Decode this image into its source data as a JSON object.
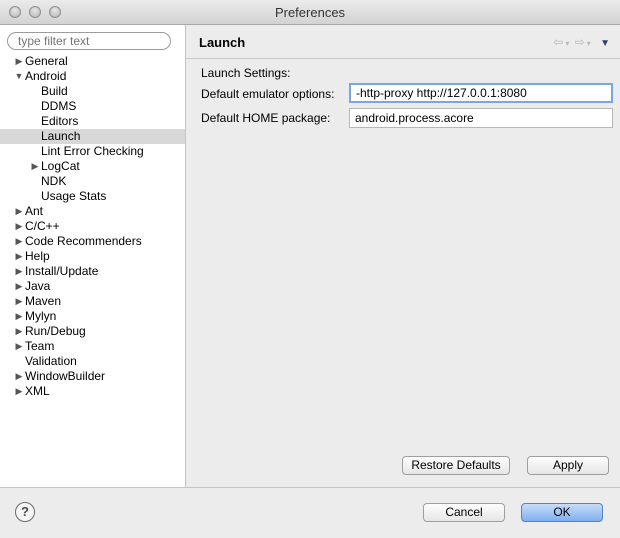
{
  "window": {
    "title": "Preferences"
  },
  "filter": {
    "placeholder": "type filter text"
  },
  "tree": [
    {
      "label": "General",
      "level": 0,
      "arrow": "right"
    },
    {
      "label": "Android",
      "level": 0,
      "arrow": "down"
    },
    {
      "label": "Build",
      "level": 1,
      "arrow": ""
    },
    {
      "label": "DDMS",
      "level": 1,
      "arrow": ""
    },
    {
      "label": "Editors",
      "level": 1,
      "arrow": ""
    },
    {
      "label": "Launch",
      "level": 1,
      "arrow": "",
      "selected": true
    },
    {
      "label": "Lint Error Checking",
      "level": 1,
      "arrow": ""
    },
    {
      "label": "LogCat",
      "level": 1,
      "arrow": "right"
    },
    {
      "label": "NDK",
      "level": 1,
      "arrow": ""
    },
    {
      "label": "Usage Stats",
      "level": 1,
      "arrow": ""
    },
    {
      "label": "Ant",
      "level": 0,
      "arrow": "right"
    },
    {
      "label": "C/C++",
      "level": 0,
      "arrow": "right"
    },
    {
      "label": "Code Recommenders",
      "level": 0,
      "arrow": "right"
    },
    {
      "label": "Help",
      "level": 0,
      "arrow": "right"
    },
    {
      "label": "Install/Update",
      "level": 0,
      "arrow": "right"
    },
    {
      "label": "Java",
      "level": 0,
      "arrow": "right"
    },
    {
      "label": "Maven",
      "level": 0,
      "arrow": "right"
    },
    {
      "label": "Mylyn",
      "level": 0,
      "arrow": "right"
    },
    {
      "label": "Run/Debug",
      "level": 0,
      "arrow": "right"
    },
    {
      "label": "Team",
      "level": 0,
      "arrow": "right"
    },
    {
      "label": "Validation",
      "level": 0,
      "arrow": ""
    },
    {
      "label": "WindowBuilder",
      "level": 0,
      "arrow": "right"
    },
    {
      "label": "XML",
      "level": 0,
      "arrow": "right"
    }
  ],
  "page": {
    "title": "Launch",
    "section_label": "Launch Settings:",
    "emulator_label": "Default emulator options:",
    "emulator_value": "-http-proxy http://127.0.0.1:8080",
    "home_label": "Default HOME package:",
    "home_value": "android.process.acore",
    "restore_label": "Restore Defaults",
    "apply_label": "Apply"
  },
  "footer": {
    "help_glyph": "?",
    "cancel_label": "Cancel",
    "ok_label": "OK"
  },
  "colors": {
    "selection": "#d8d8d8",
    "focus_ring": "#7aa7e3",
    "ok_button": "#7eb0ef"
  }
}
